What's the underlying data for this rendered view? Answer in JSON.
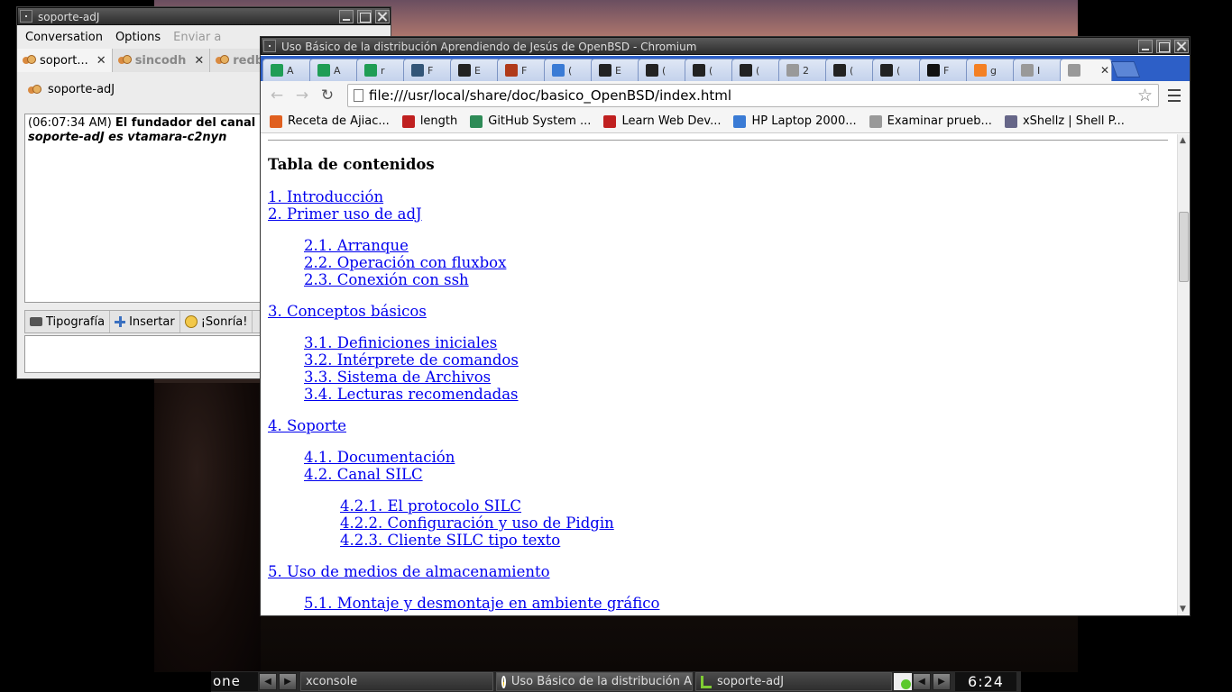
{
  "pidgin": {
    "title": "soporte-adJ",
    "menu": [
      "Conversation",
      "Options",
      "Enviar a"
    ],
    "tabs": [
      {
        "label": "soport..."
      },
      {
        "label": "sincodh"
      },
      {
        "label": "redba"
      }
    ],
    "header_name": "soporte-adJ",
    "history": {
      "time": "(06:07:34 AM)",
      "text": "El fundador del canal",
      "line2": "soporte-adJ es vtamara-c2nyn"
    },
    "toolbar": {
      "font_label": "Tipografía",
      "insert_label": "Insertar",
      "smile_label": "¡Sonría!"
    }
  },
  "chromium": {
    "title": "Uso Básico de la distribución Aprendiendo de Jesús de OpenBSD - Chromium",
    "tabs": [
      {
        "label": "A",
        "icon": "sheet-icon",
        "color": "#1f9d55"
      },
      {
        "label": "A",
        "icon": "sheet-icon",
        "color": "#1f9d55"
      },
      {
        "label": "r",
        "icon": "table-icon",
        "color": "#1f9d55"
      },
      {
        "label": "F",
        "icon": "elephant-icon",
        "color": "#335577"
      },
      {
        "label": "E",
        "icon": "tux-icon",
        "color": "#222222"
      },
      {
        "label": "F",
        "icon": "db-icon",
        "color": "#b03a1a"
      },
      {
        "label": "(",
        "icon": "globe-icon",
        "color": "#3a7bd5"
      },
      {
        "label": "E",
        "icon": "tux-icon",
        "color": "#222222"
      },
      {
        "label": "(",
        "icon": "tux-icon",
        "color": "#222222"
      },
      {
        "label": "(",
        "icon": "tux-icon",
        "color": "#222222"
      },
      {
        "label": "(",
        "icon": "tux-icon",
        "color": "#222222"
      },
      {
        "label": "2",
        "icon": "page-icon",
        "color": "#999999"
      },
      {
        "label": "(",
        "icon": "gnome-icon",
        "color": "#222222"
      },
      {
        "label": "(",
        "icon": "gnome-icon",
        "color": "#222222"
      },
      {
        "label": "F",
        "icon": "github-icon",
        "color": "#111111"
      },
      {
        "label": "g",
        "icon": "stack-icon",
        "color": "#f48024"
      },
      {
        "label": "I",
        "icon": "page-icon",
        "color": "#999999"
      },
      {
        "label": "",
        "icon": "page-icon",
        "color": "#999999",
        "active": true
      }
    ],
    "url": "file:///usr/local/share/doc/basico_OpenBSD/index.html",
    "bookmarks": [
      {
        "label": "Receta de Ajiac...",
        "icon": "recipe-icon",
        "color": "#e06020"
      },
      {
        "label": "length",
        "icon": "bird-icon",
        "color": "#c02020"
      },
      {
        "label": "GitHub System ...",
        "icon": "github-icon",
        "color": "#2e8b57"
      },
      {
        "label": "Learn Web Dev...",
        "icon": "ninja-icon",
        "color": "#c02020"
      },
      {
        "label": "HP Laptop 2000...",
        "icon": "info-icon",
        "color": "#3a7bd5"
      },
      {
        "label": "Examinar prueb...",
        "icon": "page-icon",
        "color": "#999999"
      },
      {
        "label": "xShellz | Shell P...",
        "icon": "server-icon",
        "color": "#666688"
      }
    ],
    "page": {
      "heading": "Tabla de contenidos",
      "toc": [
        {
          "text": "1. Introducción",
          "level": 1
        },
        {
          "text": "2. Primer uso de adJ",
          "level": 1
        },
        {
          "text": "2.1. Arranque",
          "level": 2
        },
        {
          "text": "2.2. Operación con fluxbox",
          "level": 2
        },
        {
          "text": "2.3. Conexión con ssh",
          "level": 2
        },
        {
          "text": "3. Conceptos básicos",
          "level": 1
        },
        {
          "text": "3.1. Definiciones iniciales",
          "level": 2
        },
        {
          "text": "3.2. Intérprete de comandos",
          "level": 2
        },
        {
          "text": "3.3. Sistema de Archivos",
          "level": 2
        },
        {
          "text": "3.4. Lecturas recomendadas",
          "level": 2
        },
        {
          "text": "4. Soporte",
          "level": 1
        },
        {
          "text": "4.1. Documentación",
          "level": 2
        },
        {
          "text": "4.2. Canal SILC",
          "level": 2
        },
        {
          "text": "4.2.1. El protocolo SILC",
          "level": 3
        },
        {
          "text": "4.2.2. Configuración y uso de Pidgin",
          "level": 3
        },
        {
          "text": "4.2.3. Cliente SILC tipo texto",
          "level": 3
        },
        {
          "text": "5. Uso de medios de almacenamiento",
          "level": 1
        },
        {
          "text": "5.1. Montaje y desmontaje en ambiente gráfico",
          "level": 2
        }
      ]
    }
  },
  "taskbar": {
    "workspace": "one",
    "tasks": [
      {
        "label": "xconsole",
        "icon": ""
      },
      {
        "label": "Uso Básico de la distribución A",
        "icon": "chrome-icon"
      },
      {
        "label": "soporte-adJ",
        "icon": "pidgin-icon"
      }
    ],
    "clock": "6:24"
  }
}
